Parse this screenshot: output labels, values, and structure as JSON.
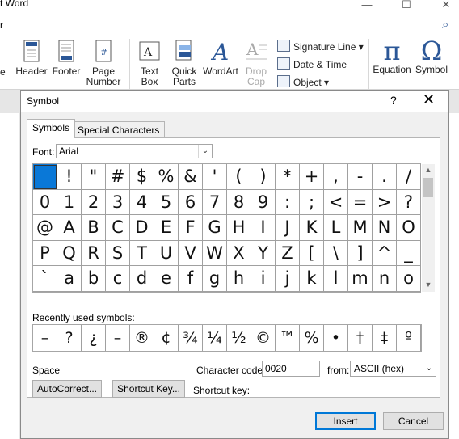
{
  "app": {
    "title": "t Word",
    "menu_fragment": "r"
  },
  "ribbon": {
    "header": "Header",
    "footer": "Footer",
    "page_number_1": "Page",
    "page_number_2": "Number",
    "text_box_1": "Text",
    "text_box_2": "Box",
    "quick_parts_1": "Quick",
    "quick_parts_2": "Parts",
    "wordart": "WordArt",
    "drop_cap_1": "Drop",
    "drop_cap_2": "Cap",
    "signature_line": "Signature Line",
    "date_time": "Date & Time",
    "object": "Object",
    "equation": "Equation",
    "symbol": "Symbol",
    "left_fragment": "e"
  },
  "dialog": {
    "title": "Symbol",
    "help": "?",
    "close": "✕",
    "tabs": [
      "Symbols",
      "Special Characters"
    ],
    "font_label": "Font:",
    "font_value": "Arial",
    "symbol_rows": [
      [
        " ",
        "!",
        "\"",
        "#",
        "$",
        "%",
        "&",
        "'",
        "(",
        ")",
        "*",
        "+",
        ",",
        "-",
        ".",
        "/"
      ],
      [
        "0",
        "1",
        "2",
        "3",
        "4",
        "5",
        "6",
        "7",
        "8",
        "9",
        ":",
        ";",
        "<",
        "=",
        ">",
        "?"
      ],
      [
        "@",
        "A",
        "B",
        "C",
        "D",
        "E",
        "F",
        "G",
        "H",
        "I",
        "J",
        "K",
        "L",
        "M",
        "N",
        "O"
      ],
      [
        "P",
        "Q",
        "R",
        "S",
        "T",
        "U",
        "V",
        "W",
        "X",
        "Y",
        "Z",
        "[",
        "\\",
        "]",
        "^",
        "_"
      ],
      [
        "`",
        "a",
        "b",
        "c",
        "d",
        "e",
        "f",
        "g",
        "h",
        "i",
        "j",
        "k",
        "l",
        "m",
        "n",
        "o"
      ]
    ],
    "recent_label": "Recently used symbols:",
    "recent_symbols": [
      "–",
      "?",
      "¿",
      "–",
      "®",
      "¢",
      "¾",
      "¼",
      "½",
      "©",
      "™",
      "%",
      "•",
      "†",
      "‡",
      "º"
    ],
    "char_name": "Space",
    "code_label": "Character code:",
    "code_value": "0020",
    "from_label": "from:",
    "from_value": "ASCII (hex)",
    "autocorrect": "AutoCorrect...",
    "shortcut_key_btn": "Shortcut Key...",
    "shortcut_key_label": "Shortcut key:",
    "insert": "Insert",
    "cancel": "Cancel"
  },
  "colors": {
    "selection": "#0a78d7",
    "accent": "#2b5797"
  }
}
